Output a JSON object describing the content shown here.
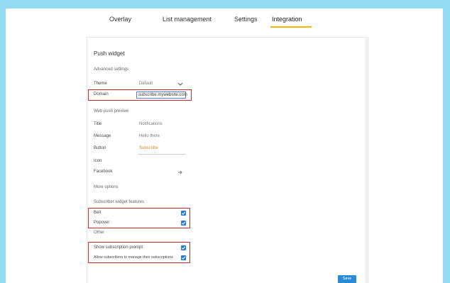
{
  "tabs": [
    {
      "label": "Overlay"
    },
    {
      "label": "List management"
    },
    {
      "label": "Settings"
    },
    {
      "label": "Integration"
    }
  ],
  "panel": {
    "title": "Push widget",
    "sections": {
      "settings_heading": "Advanced settings",
      "theme_label": "Theme",
      "theme_value": "Default",
      "domain_label": "Domain",
      "domain_value": "subscribe.mywebsite.com",
      "preview_heading": "Web push preview",
      "title_label": "Title",
      "title_value": "Notifications",
      "message_label": "Message",
      "message_value": "Hello there",
      "button_label": "Button",
      "button_value": "Subscribe",
      "icon_label": "Icon",
      "share_label": "Facebook",
      "more_label": "More options",
      "features_heading": "Subscriber widget features",
      "feature_1_label": "Bell",
      "feature_2_label": "Popover",
      "misc_label": "Other",
      "feature_3_label": "Show subscription prompt",
      "feature_4_label": "Allow subscribers to manage their subscriptions"
    },
    "save_label": "Save"
  },
  "colors": {
    "band": "#93dcf4",
    "accent_tab": "#f5b800",
    "highlight": "#d9262e",
    "checkbox": "#2979d8",
    "button": "#2a8bd9"
  }
}
